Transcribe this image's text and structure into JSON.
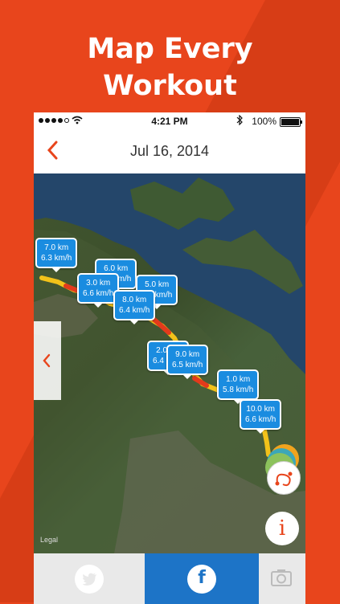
{
  "promo": {
    "line1": "Map Every",
    "line2": "Workout"
  },
  "status_bar": {
    "time": "4:21 PM",
    "battery": "100%"
  },
  "nav": {
    "title": "Jul 16, 2014"
  },
  "map": {
    "legal": "Legal",
    "markers": [
      {
        "distance": "7.0 km",
        "pace": "6.3 km/h"
      },
      {
        "distance": "6.0 km",
        "pace": "6.4 km/h"
      },
      {
        "distance": "3.0 km",
        "pace": "6.6 km/h"
      },
      {
        "distance": "5.0 km",
        "pace": "6.4 km/h"
      },
      {
        "distance": "8.0 km",
        "pace": "6.4 km/h"
      },
      {
        "distance": "2.0 km",
        "pace": "6.4 km/h"
      },
      {
        "distance": "9.0 km",
        "pace": "6.5 km/h"
      },
      {
        "distance": "1.0 km",
        "pace": "5.8 km/h"
      },
      {
        "distance": "10.0 km",
        "pace": "6.6 km/h"
      }
    ],
    "info_label": "i"
  },
  "tabbar": {
    "facebook_label": "f"
  },
  "colors": {
    "accent": "#e8451c",
    "marker": "#1a8ce0",
    "facebook": "#1d74c7"
  },
  "icons": {
    "back": "chevron-left-icon",
    "twitter": "twitter-icon",
    "camera": "camera-icon",
    "route": "route-icon"
  }
}
